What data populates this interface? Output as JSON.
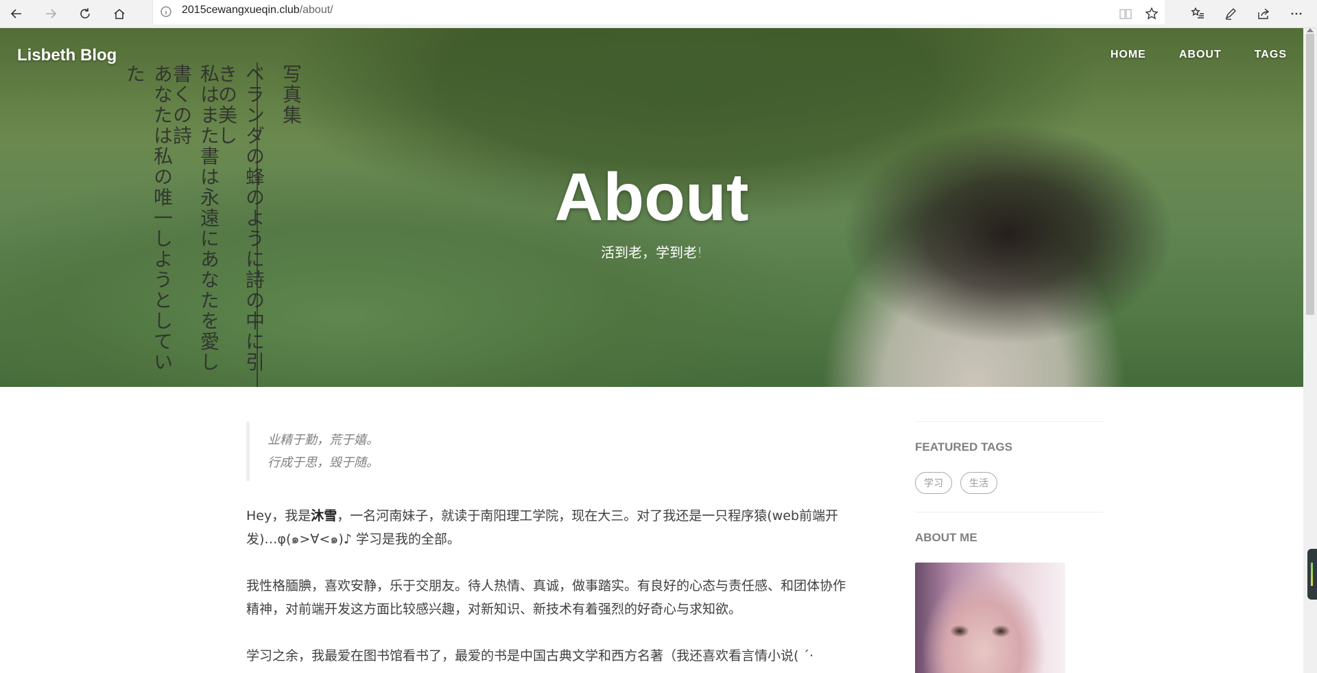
{
  "browser": {
    "url_host": "2015cewangxueqin.club",
    "url_path": "/about/"
  },
  "site": {
    "brand": "Lisbeth Blog",
    "nav": [
      "HOME",
      "ABOUT",
      "TAGS"
    ]
  },
  "hero": {
    "title": "About",
    "subtitle": "活到老，学到老!",
    "vertical_text": [
      "写真集",
      "ベランダの蜂のように詩の中に引きの美し",
      "私はまた書は永遠にあなたを愛し書くの詩",
      "あなたは私の唯一しようとしていた"
    ]
  },
  "post": {
    "quote": [
      "业精于勤，荒于嬉。",
      "行成于思，毁于随。"
    ],
    "p1_before": "Hey，我是",
    "p1_name": "沐雪",
    "p1_after": "，一名河南妹子，就读于南阳理工学院，现在大三。对了我还是一只程序猿(web前端开发)…φ(๑>∀<๑)♪ 学习是我的全部。",
    "p2": "我性格腼腆，喜欢安静，乐于交朋友。待人热情、真诚，做事踏实。有良好的心态与责任感、和团体协作精神，对前端开发这方面比较感兴趣，对新知识、新技术有着强烈的好奇心与求知欲。",
    "p3": "学习之余，我最爱在图书馆看书了，最爱的书是中国古典文学和西方名著（我还喜欢看言情小说( ˊ·"
  },
  "sidebar": {
    "featured_title": "FEATURED TAGS",
    "tags": [
      "学习",
      "生活"
    ],
    "about_title": "ABOUT ME"
  }
}
